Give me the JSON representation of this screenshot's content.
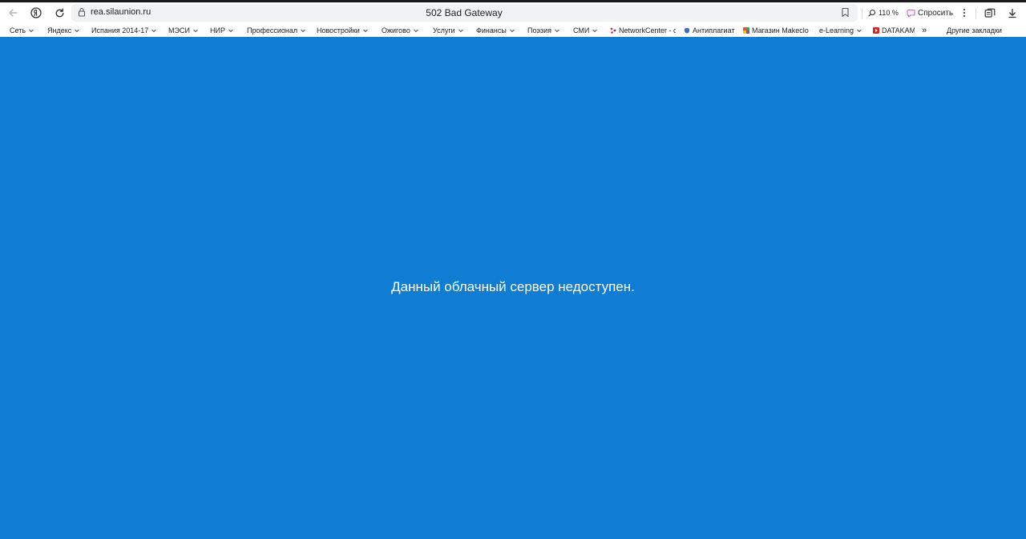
{
  "browser": {
    "address": {
      "url": "rea.silaunion.ru",
      "title": "502 Bad Gateway"
    },
    "zoom": "110 %",
    "ask_label": "Спросить"
  },
  "bookmarks": {
    "items": [
      {
        "label": "Сеть"
      },
      {
        "label": "Яндекс"
      },
      {
        "label": "Испания 2014-17"
      },
      {
        "label": "МЭСИ"
      },
      {
        "label": "НИР"
      },
      {
        "label": "Профессионал"
      },
      {
        "label": "Новостройки"
      },
      {
        "label": "Ожигово"
      },
      {
        "label": "Услуги"
      },
      {
        "label": "Финансы"
      },
      {
        "label": "Поэзия"
      },
      {
        "label": "СМИ"
      },
      {
        "label": "NetworkCenter - с"
      },
      {
        "label": "Антиплагиат"
      },
      {
        "label": "Магазин Makeclo"
      },
      {
        "label": "e-Learning"
      },
      {
        "label": "DATAKAM"
      }
    ],
    "more": "»",
    "other": "Другие закладки"
  },
  "page": {
    "message": "Данный облачный сервер недоступен.",
    "background_color": "#0f7dd3"
  },
  "colors": {
    "page_background": "#0f7dd3",
    "message_text": "#ffffff",
    "ask_icon": "#d45fc8"
  }
}
